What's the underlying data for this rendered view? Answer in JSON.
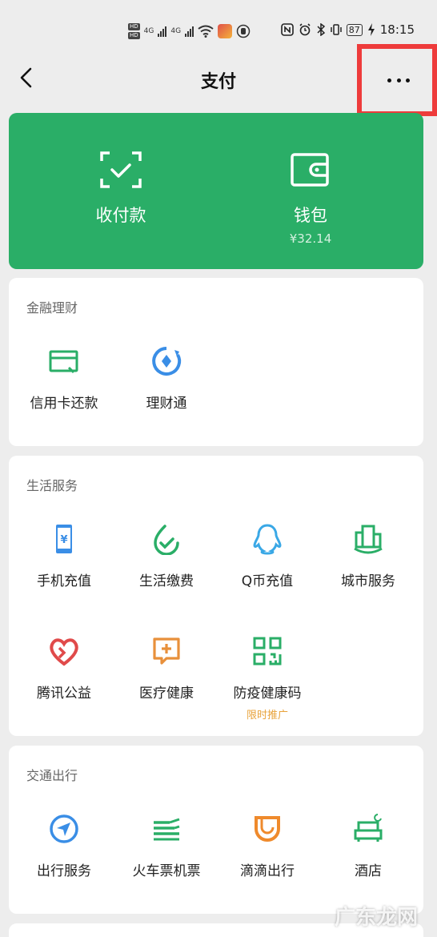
{
  "status": {
    "battery": "87",
    "time": "18:15",
    "network1": "4G",
    "network2": "4G",
    "hd1": "HD",
    "hd2": "HD"
  },
  "nav": {
    "title": "支付",
    "back_icon": "chevron-left-icon",
    "more_icon": "more-dots-icon"
  },
  "hero": {
    "collect": {
      "label": "收付款",
      "icon": "scan-check-icon"
    },
    "wallet": {
      "label": "钱包",
      "balance": "¥32.14",
      "icon": "wallet-icon"
    }
  },
  "finance": {
    "title": "金融理财",
    "items": [
      {
        "label": "信用卡还款",
        "icon": "credit-card-icon"
      },
      {
        "label": "理财通",
        "icon": "wealth-icon"
      }
    ]
  },
  "life": {
    "title": "生活服务",
    "items": [
      {
        "label": "手机充值",
        "icon": "phone-recharge-icon"
      },
      {
        "label": "生活缴费",
        "icon": "bill-pay-icon"
      },
      {
        "label": "Q币充值",
        "icon": "qq-coin-icon"
      },
      {
        "label": "城市服务",
        "icon": "city-service-icon"
      },
      {
        "label": "腾讯公益",
        "icon": "charity-heart-icon"
      },
      {
        "label": "医疗健康",
        "icon": "medical-icon"
      },
      {
        "label": "防疫健康码",
        "icon": "qr-code-icon",
        "tag": "限时推广"
      }
    ]
  },
  "transport": {
    "title": "交通出行",
    "items": [
      {
        "label": "出行服务",
        "icon": "navigation-icon"
      },
      {
        "label": "火车票机票",
        "icon": "train-icon"
      },
      {
        "label": "滴滴出行",
        "icon": "didi-icon"
      },
      {
        "label": "酒店",
        "icon": "hotel-bed-icon"
      }
    ]
  },
  "colors": {
    "brand_green": "#2aae67",
    "highlight_red": "#ee3b3b",
    "promo_orange": "#e8a33b"
  },
  "watermark": "广东龙网"
}
